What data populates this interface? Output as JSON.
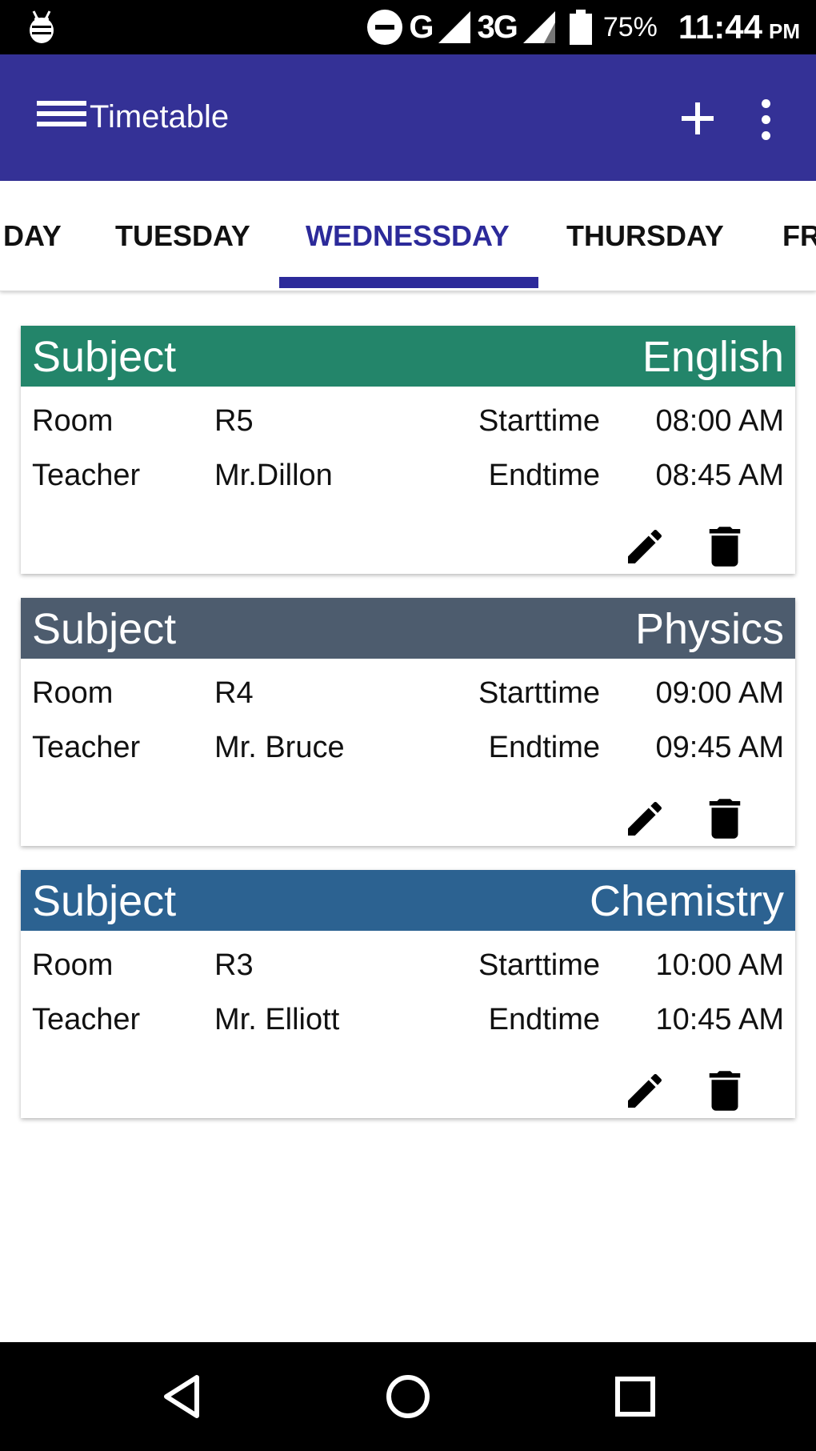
{
  "status_bar": {
    "network_1": "G",
    "network_2": "3G",
    "battery": "75%",
    "time": "11:44",
    "ampm": "PM"
  },
  "app_bar": {
    "title": "Timetable",
    "icons": [
      "menu-icon",
      "add-icon",
      "more-vert-icon"
    ]
  },
  "tabs": [
    {
      "label": "DAY",
      "active": false
    },
    {
      "label": "TUESDAY",
      "active": false
    },
    {
      "label": "WEDNESSDAY",
      "active": true
    },
    {
      "label": "THURSDAY",
      "active": false
    },
    {
      "label": "FR",
      "active": false
    }
  ],
  "accent_color": "#343196",
  "cards": [
    {
      "subject_label": "Subject",
      "subject": "English",
      "header_color": "#23856a",
      "room_label": "Room",
      "room": "R5",
      "teacher_label": "Teacher",
      "teacher": "Mr.Dillon",
      "start_label": "Starttime",
      "start": "08:00 AM",
      "end_label": "Endtime",
      "end": "08:45 AM"
    },
    {
      "subject_label": "Subject",
      "subject": "Physics",
      "header_color": "#4d5c6e",
      "room_label": "Room",
      "room": "R4",
      "teacher_label": "Teacher",
      "teacher": "Mr. Bruce",
      "start_label": "Starttime",
      "start": "09:00 AM",
      "end_label": "Endtime",
      "end": "09:45 AM"
    },
    {
      "subject_label": "Subject",
      "subject": "Chemistry",
      "header_color": "#2c6291",
      "room_label": "Room",
      "room": "R3",
      "teacher_label": "Teacher",
      "teacher": "Mr. Elliott",
      "start_label": "Starttime",
      "start": "10:00 AM",
      "end_label": "Endtime",
      "end": "10:45 AM"
    }
  ],
  "nav_bar": {
    "icons": [
      "back-icon",
      "home-icon",
      "recents-icon"
    ]
  }
}
